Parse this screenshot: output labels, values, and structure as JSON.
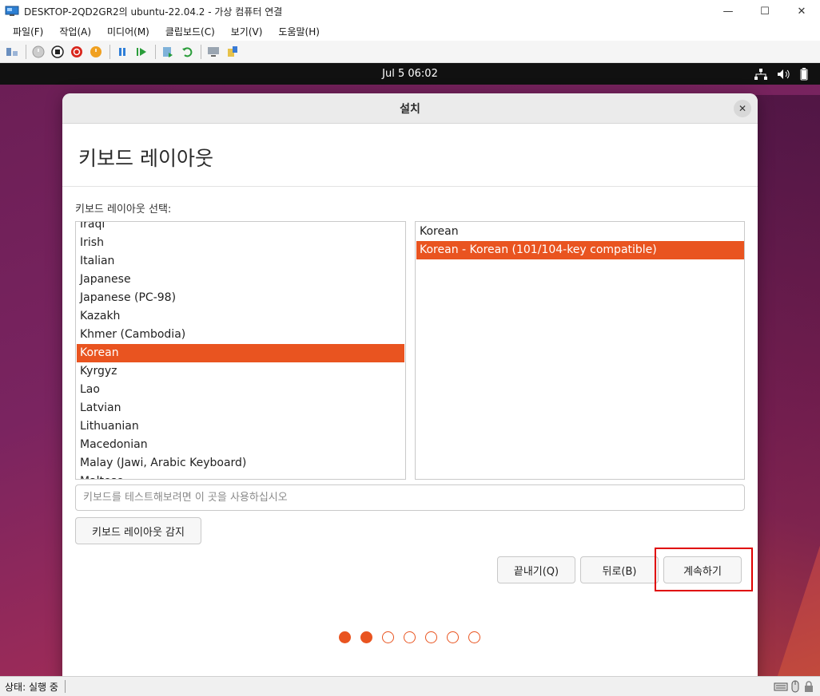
{
  "window": {
    "title": "DESKTOP-2QD2GR2의 ubuntu-22.04.2 - 가상 컴퓨터 연결",
    "minimize": "—",
    "maximize": "☐",
    "close": "✕"
  },
  "menu": {
    "items": [
      "파일(F)",
      "작업(A)",
      "미디어(M)",
      "클립보드(C)",
      "보기(V)",
      "도움말(H)"
    ]
  },
  "toolbar": {
    "icons": [
      "ctrl-alt-del-icon",
      "start-icon",
      "turn-off-icon",
      "shutdown-icon",
      "save-icon",
      "pause-icon",
      "resume-icon",
      "checkpoint-icon",
      "revert-icon",
      "enhanced-session-icon",
      "share-icon"
    ]
  },
  "guest": {
    "topbar_time": "Jul 5  06:02"
  },
  "dialog": {
    "title": "설치",
    "heading": "키보드 레이아웃",
    "select_label": "키보드 레이아웃 선택:",
    "layouts": [
      "Iraqi",
      "Irish",
      "Italian",
      "Japanese",
      "Japanese (PC-98)",
      "Kazakh",
      "Khmer (Cambodia)",
      "Korean",
      "Kyrgyz",
      "Lao",
      "Latvian",
      "Lithuanian",
      "Macedonian",
      "Malay (Jawi, Arabic Keyboard)",
      "Maltese"
    ],
    "selected_layout": "Korean",
    "variants": [
      "Korean",
      "Korean - Korean (101/104-key compatible)"
    ],
    "selected_variant": "Korean - Korean (101/104-key compatible)",
    "test_placeholder": "키보드를 테스트해보려면 이 곳을 사용하십시오",
    "detect_button": "키보드 레이아웃 감지",
    "quit_button": "끝내기(Q)",
    "back_button": "뒤로(B)",
    "continue_button": "계속하기",
    "progress": {
      "total": 7,
      "completed": 2
    }
  },
  "statusbar": {
    "status": "상태: 실행 중"
  },
  "colors": {
    "accent": "#e95420",
    "highlight_box": "#e00000"
  }
}
